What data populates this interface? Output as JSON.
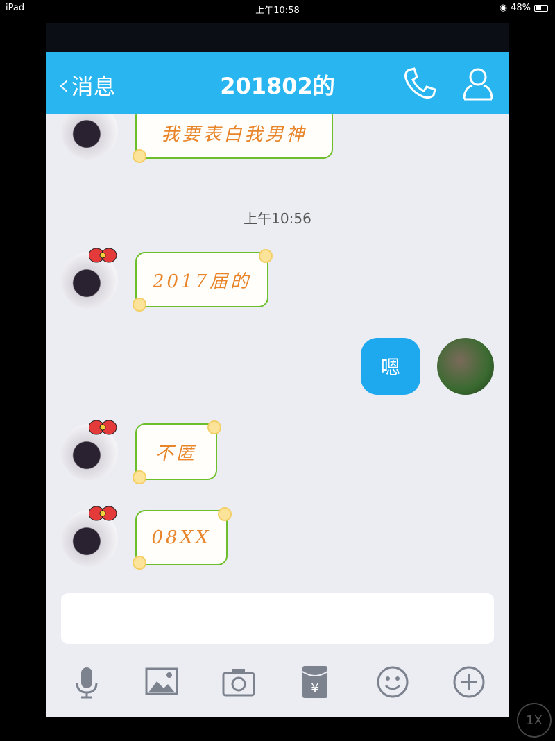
{
  "status_bar": {
    "device": "iPad",
    "time": "上午10:58",
    "battery": "48%",
    "battery_level": 0.48
  },
  "header": {
    "back_label": "消息",
    "title": "201802的"
  },
  "messages": [
    {
      "side": "left",
      "text": "我要表白我男神"
    },
    {
      "type": "timestamp",
      "text": "上午10:56"
    },
    {
      "side": "left",
      "text": "2017届的"
    },
    {
      "side": "right",
      "text": "嗯"
    },
    {
      "side": "left",
      "text": "不匿"
    },
    {
      "side": "left",
      "text": "08XX"
    }
  ],
  "input": {
    "value": ""
  },
  "toolbar": [
    "microphone-icon",
    "image-icon",
    "camera-icon",
    "red-packet-icon",
    "emoji-icon",
    "plus-icon"
  ],
  "overlay": {
    "zoom_label": "1X"
  },
  "colors": {
    "header": "#29b6f0",
    "bubble_mine": "#1ea9ef",
    "bubble_border": "#6cbf2a",
    "bubble_text": "#e8852a"
  }
}
